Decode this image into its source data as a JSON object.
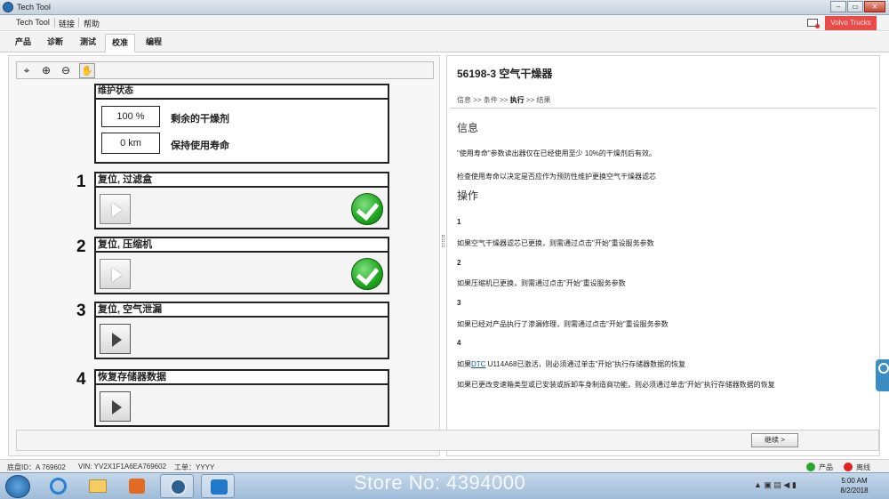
{
  "window": {
    "title": "Tech Tool",
    "buttons": {
      "minimize": "–",
      "restore": "▭",
      "close": "✕"
    }
  },
  "menubar": {
    "items": [
      "Tech Tool",
      "链接",
      "帮助"
    ],
    "status_button": "Volvo Trucks"
  },
  "tabs": [
    "产品",
    "诊断",
    "测试",
    "校准",
    "编程"
  ],
  "active_tab": "校准",
  "toolbar": {
    "icons": [
      "zoom-fit-icon",
      "zoom-in-icon",
      "zoom-out-icon",
      "pan-hand-icon"
    ],
    "glyphs": [
      "⌖",
      "⊕",
      "⊖",
      "✋"
    ]
  },
  "maintenance": {
    "header": "维护状态",
    "rows": [
      {
        "value": "100 %",
        "label": "剩余的干燥剂"
      },
      {
        "value": "0 km",
        "label": "保持使用寿命"
      }
    ]
  },
  "steps": [
    {
      "number": "1",
      "title": "复位, 过滤盒",
      "done": true
    },
    {
      "number": "2",
      "title": "复位, 压缩机",
      "done": true
    },
    {
      "number": "3",
      "title": "复位, 空气泄漏",
      "done": false
    },
    {
      "number": "4",
      "title": "恢复存储器数据",
      "done": false
    }
  ],
  "continue_button": "继续 >",
  "right": {
    "title": "56198-3 空气干燥器",
    "breadcrumb": {
      "pre": "信息 >> 条件 >> ",
      "current": "执行",
      "post": " >> 结果"
    },
    "info_heading": "信息",
    "info_lines": [
      "\"使用寿命\"参数读出器仅在已经使用至少 10%的干燥剂后有效。",
      "检查使用寿命以决定是否应作为预防性维护更换空气干燥器滤芯"
    ],
    "op_heading": "操作",
    "ops": [
      {
        "num": "1",
        "text": "如果空气干燥器滤芯已更换，则需通过点击\"开始\"重设服务参数"
      },
      {
        "num": "2",
        "text": "如果压缩机已更换，则需通过点击\"开始\"重设服务参数"
      },
      {
        "num": "3",
        "text": "如果已经对产品执行了渗漏修理，则需通过点击\"开始\"重设服务参数"
      },
      {
        "num": "4",
        "text_link": "DTC",
        "text": " U114A68已激活，则必须通过单击\"开始\"执行存储器数据的恢复",
        "text_prefix": "如果"
      }
    ],
    "extra_line": "如果已更改变速箱类型或已安装或拆卸车身制造商功能，则必须通过单击\"开始\"执行存储器数据的恢复"
  },
  "statusbar": {
    "chassis": "底盘ID：A 769602",
    "vin": "VIN: YV2X1F1A6EA769602",
    "work": "工单：YYYY",
    "product": "产品",
    "offline": "离线"
  },
  "taskbar": {
    "watermark": "Store No: 4394000",
    "tray_icons": "▲ ▣ ▤ ◀ ▮",
    "time": "5:00 AM",
    "date": "8/2/2018"
  }
}
